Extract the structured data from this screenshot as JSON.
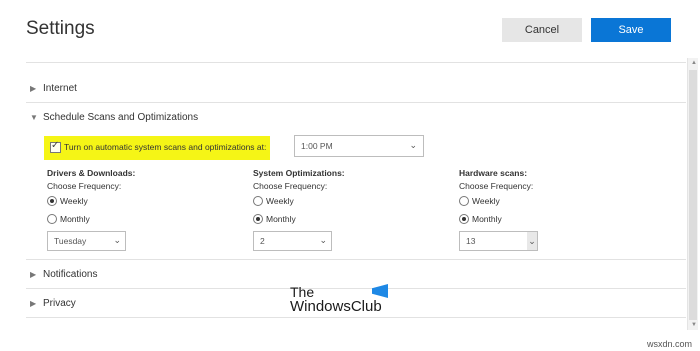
{
  "header": {
    "title": "Settings",
    "cancel_label": "Cancel",
    "save_label": "Save"
  },
  "sections": {
    "internet": "Internet",
    "schedule": "Schedule Scans and Optimizations",
    "notifications": "Notifications",
    "privacy": "Privacy"
  },
  "schedule": {
    "auto_scan_label": "Turn on automatic system scans and optimizations at:",
    "auto_scan_checked": true,
    "time_value": "1:00 PM",
    "columns": [
      {
        "heading": "Drivers & Downloads:",
        "sub": "Choose Frequency:",
        "weekly": "Weekly",
        "monthly": "Monthly",
        "selected": "weekly",
        "dropdown": "Tuesday"
      },
      {
        "heading": "System Optimizations:",
        "sub": "Choose Frequency:",
        "weekly": "Weekly",
        "monthly": "Monthly",
        "selected": "monthly",
        "dropdown": "2"
      },
      {
        "heading": "Hardware scans:",
        "sub": "Choose Frequency:",
        "weekly": "Weekly",
        "monthly": "Monthly",
        "selected": "monthly",
        "dropdown": "13"
      }
    ]
  },
  "watermark": {
    "line1": "The",
    "line2": "WindowsClub"
  },
  "footer": "wsxdn.com",
  "colors": {
    "accent": "#0a76d6",
    "highlight": "#f5f516"
  }
}
